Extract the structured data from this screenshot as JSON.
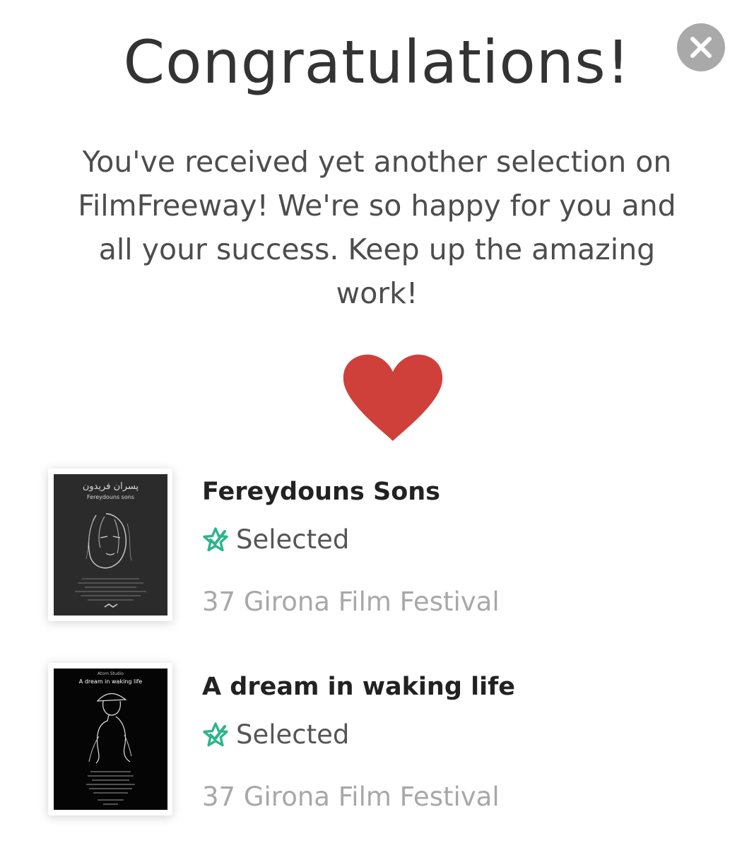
{
  "modal": {
    "title": "Congratulations!",
    "message": "You've received yet another selection on FilmFreeway! We're so happy for you and all your success. Keep up the amazing work!",
    "close_icon": "close-icon",
    "heart_icon": "heart-icon",
    "heart_color": "#d0403a"
  },
  "selections": [
    {
      "title": "Fereydouns Sons",
      "status": "Selected",
      "festival": "37 Girona Film Festival",
      "poster": {
        "title_persian": "پسران فریدون",
        "title_english": "Fereydouns sons"
      }
    },
    {
      "title": "A dream in waking life",
      "status": "Selected",
      "festival": "37 Girona Film Festival",
      "poster": {
        "studio": "Atom Studio",
        "title": "A dream in waking life"
      }
    }
  ],
  "colors": {
    "status_icon": "#2bb58a",
    "close_bg": "#a9a9a9"
  }
}
